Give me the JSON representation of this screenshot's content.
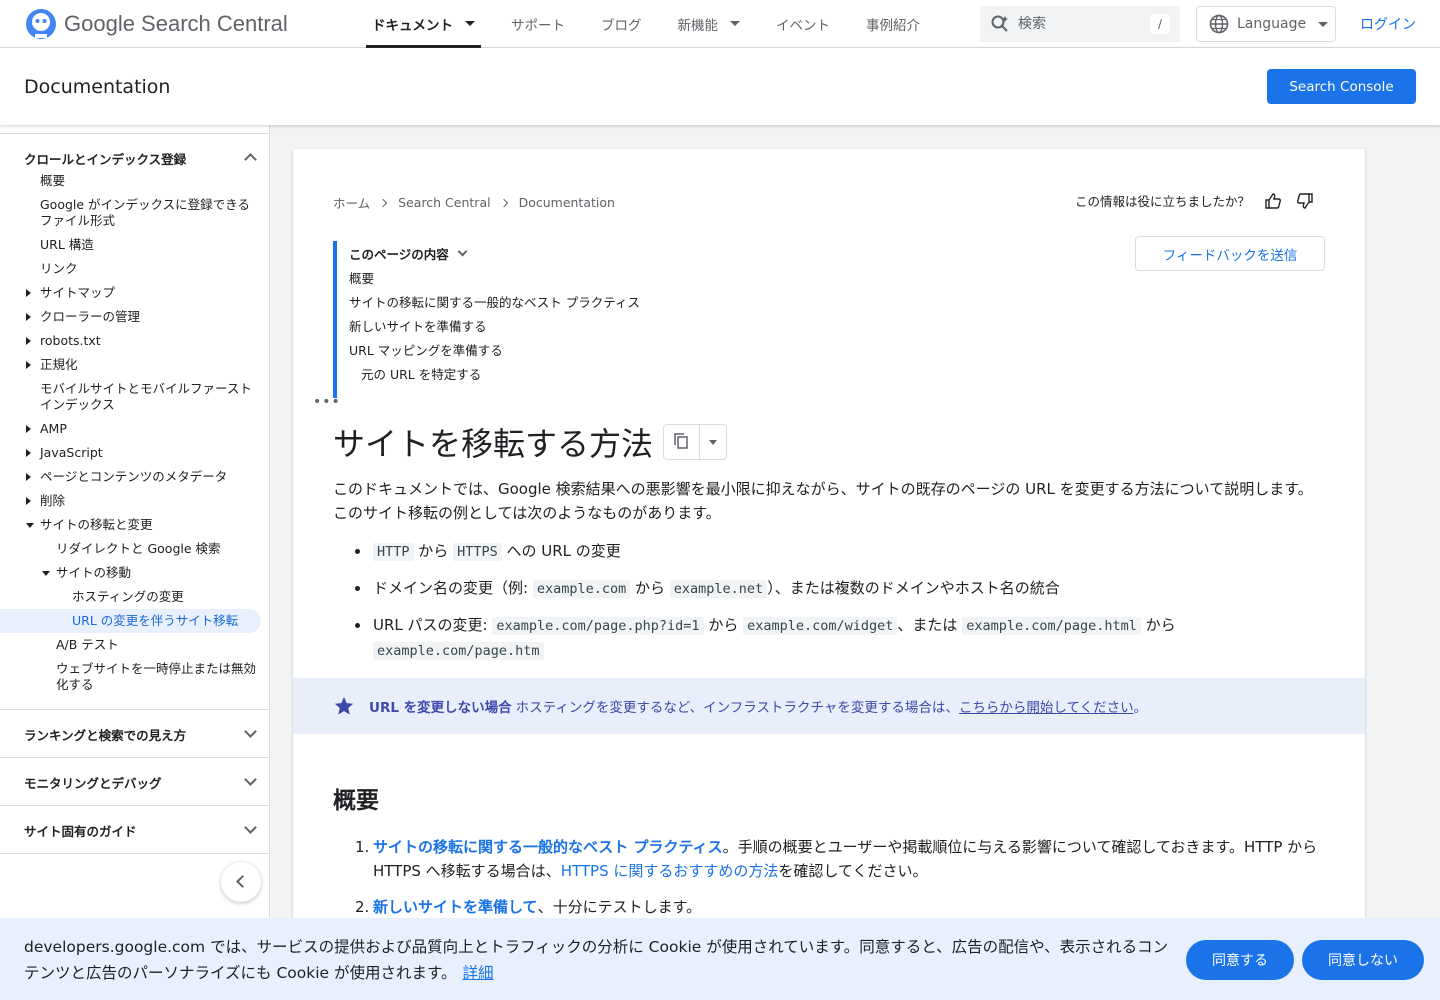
{
  "header": {
    "logo_text": "Google Search Central",
    "nav": [
      {
        "label": "ドキュメント",
        "dropdown": true,
        "active": true
      },
      {
        "label": "サポート",
        "dropdown": false
      },
      {
        "label": "ブログ",
        "dropdown": false
      },
      {
        "label": "新機能",
        "dropdown": true
      },
      {
        "label": "イベント",
        "dropdown": false
      },
      {
        "label": "事例紹介",
        "dropdown": false
      }
    ],
    "search_placeholder": "検索",
    "search_shortcut": "/",
    "language_label": "Language",
    "login_label": "ログイン"
  },
  "subheader": {
    "title": "Documentation",
    "search_console_label": "Search Console"
  },
  "sidebar": {
    "section_crawl": "クロールとインデックス登録",
    "items": [
      "概要",
      "Google がインデックスに登録できるファイル形式",
      "URL 構造",
      "リンク",
      "サイトマップ",
      "クローラーの管理",
      "robots.txt",
      "正規化",
      "モバイルサイトとモバイルファースト インデックス",
      "AMP",
      "JavaScript",
      "ページとコンテンツのメタデータ",
      "削除",
      "サイトの移転と変更",
      "リダイレクトと Google 検索",
      "サイトの移動",
      "ホスティングの変更",
      "URL の変更を伴うサイト移転",
      "A/B テスト",
      "ウェブサイトを一時停止または無効化する"
    ],
    "section_ranking": "ランキングと検索での見え方",
    "section_monitoring": "モニタリングとデバッグ",
    "section_guides": "サイト固有のガイド"
  },
  "breadcrumb": [
    "ホーム",
    "Search Central",
    "Documentation"
  ],
  "helpful_text": "この情報は役に立ちましたか？",
  "feedback_label": "フィードバックを送信",
  "toc": {
    "title": "このページの内容",
    "items": [
      "概要",
      "サイトの移転に関する一般的なベスト プラクティス",
      "新しいサイトを準備する",
      "URL マッピングを準備する",
      "元の URL を特定する"
    ],
    "more": "•••"
  },
  "article": {
    "title": "サイトを移転する方法",
    "intro": "このドキュメントでは、Google 検索結果への悪影響を最小限に抑えながら、サイトの既存のページの URL を変更する方法について説明します。このサイト移転の例としては次のようなものがあります。",
    "b1": {
      "c1": "HTTP",
      "t1": " から ",
      "c2": "HTTPS",
      "t2": " への URL の変更"
    },
    "b2": {
      "t1": "ドメイン名の変更（例: ",
      "c1": "example.com",
      "t2": " から ",
      "c2": "example.net",
      "t3": "）、または複数のドメインやホスト名の統合"
    },
    "b3": {
      "t1": "URL パスの変更: ",
      "c1": "example.com/page.php?id=1",
      "t2": " から ",
      "c2": "example.com/widget",
      "t3": "、または ",
      "c3": "example.com/page.html",
      "t4": " から ",
      "c4": "example.com/page.htm"
    },
    "note": {
      "bold": "URL を変更しない場合",
      "text": "ホスティングを変更するなど、インフラストラクチャを変更する場合は、",
      "link": "こちらから開始してください",
      "end": "。"
    },
    "h2": "概要",
    "ol1": {
      "num": "1.",
      "link": "サイトの移転に関する一般的なベスト プラクティス",
      "t1": "。手順の概要とユーザーや掲載順位に与える影響について確認しておきます。HTTP から HTTPS へ移転する場合は、",
      "link2": "HTTPS に関するおすすめの方法",
      "t2": "を確認してください。"
    },
    "ol2": {
      "num": "2.",
      "link": "新しいサイトを準備して",
      "t1": "、十分にテストします。"
    }
  },
  "cookie": {
    "text": "developers.google.com では、サービスの提供および品質向上とトラフィックの分析に Cookie が使用されています。同意すると、広告の配信や、表示されるコンテンツと広告のパーソナライズにも Cookie が使用されます。",
    "details": "詳細",
    "agree": "同意する",
    "disagree": "同意しない"
  },
  "colors": {
    "accent": "#1a73e8",
    "note_bg": "#e8eefa",
    "note_text": "#3c4ba9"
  }
}
